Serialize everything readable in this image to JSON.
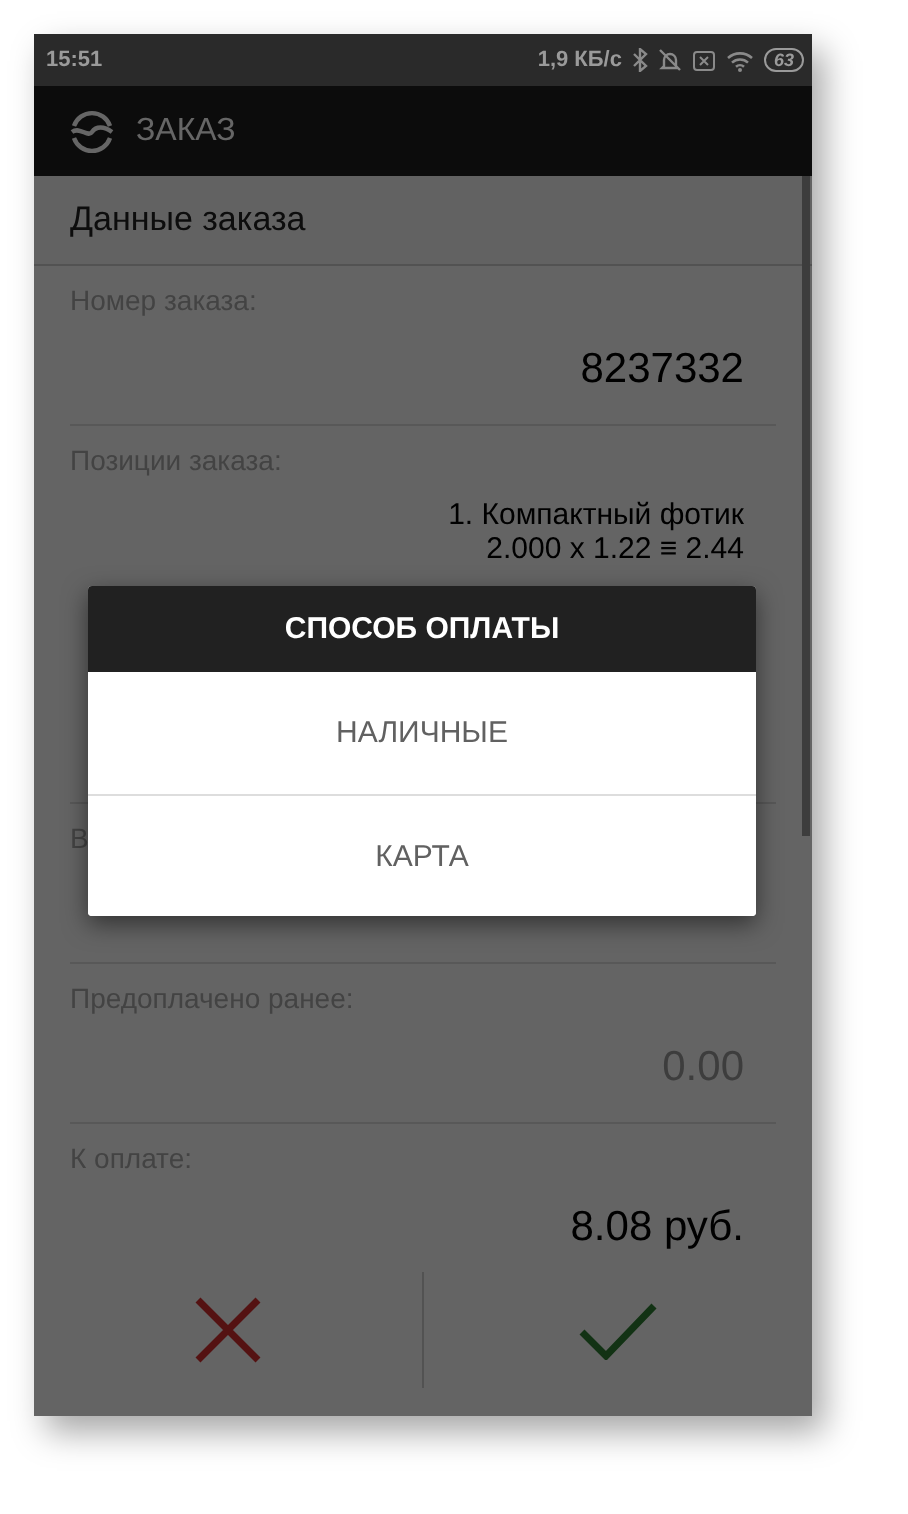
{
  "status_bar": {
    "time": "15:51",
    "speed": "1,9 КБ/с",
    "battery": "63"
  },
  "app_bar": {
    "title": "ЗАКАЗ"
  },
  "section": {
    "title": "Данные заказа"
  },
  "fields": [
    {
      "kind": "single",
      "label": "Номер заказа:",
      "lines": [
        "8237332"
      ],
      "muted": false
    },
    {
      "kind": "items",
      "label": "Позиции заказа:",
      "lines": [
        "1. Компактный фотик",
        "2.000 x 1.22 ≡ 2.44"
      ]
    },
    {
      "kind": "single",
      "label": "В"
    },
    {
      "kind": "single",
      "label": "Предоплачено ранее:",
      "lines": [
        "0.00"
      ],
      "muted": true
    },
    {
      "kind": "single",
      "label": "К оплате:",
      "lines": [
        "8.08 руб."
      ],
      "muted": false
    }
  ],
  "dialog": {
    "title": "СПОСОБ ОПЛАТЫ",
    "options": [
      "НАЛИЧНЫЕ",
      "КАРТА"
    ]
  }
}
